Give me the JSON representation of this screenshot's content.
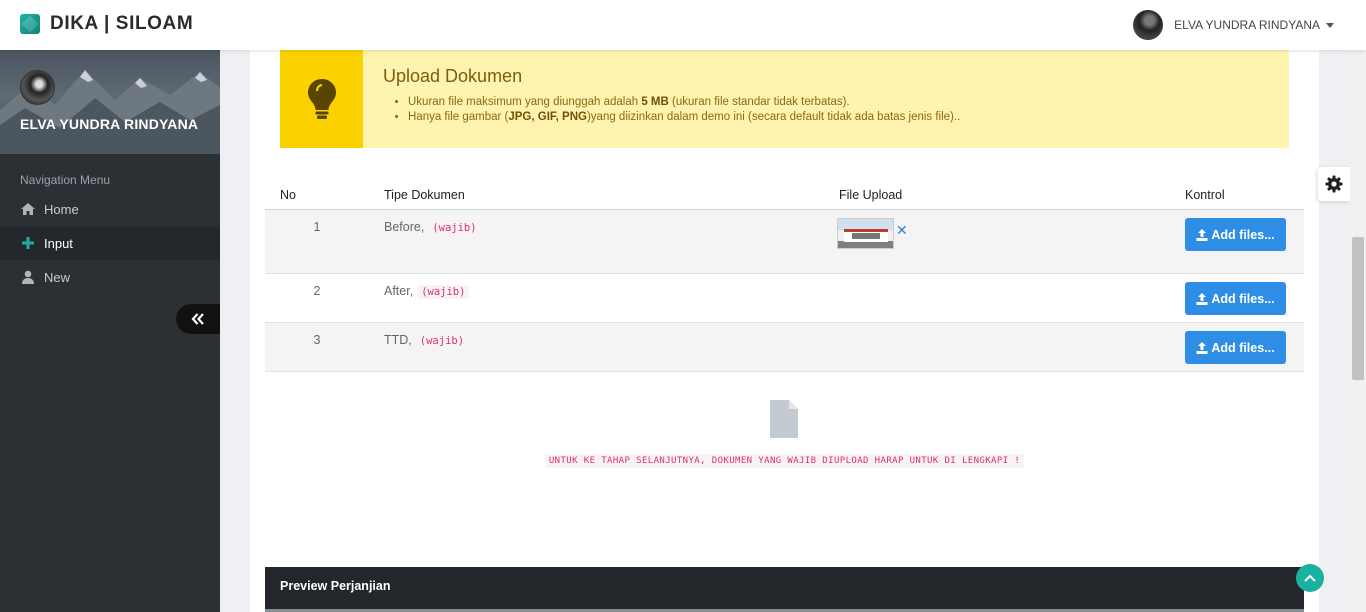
{
  "app": {
    "brand": "DIKA | SILOAM"
  },
  "header": {
    "user_name": "ELVA YUNDRA RINDYANA"
  },
  "sidebar": {
    "profile_name": "ELVA YUNDRA RINDYANA",
    "nav_title": "Navigation Menu",
    "items": [
      {
        "label": "Home",
        "icon": "home-icon"
      },
      {
        "label": "Input",
        "icon": "plus-icon",
        "active": true
      },
      {
        "label": "New",
        "icon": "user-icon"
      }
    ]
  },
  "alert": {
    "title": "Upload Dokumen",
    "line1_pre": "Ukuran file maksimum yang diunggah adalah ",
    "line1_bold": "5 MB",
    "line1_post": " (ukuran file standar tidak terbatas).",
    "line2_pre": "Hanya file gambar (",
    "line2_bold": "JPG, GIF, PNG",
    "line2_post": ")yang diizinkan dalam demo ini (secara default tidak ada batas jenis file).."
  },
  "table": {
    "headers": {
      "no": "No",
      "type": "Tipe Dokumen",
      "file": "File Upload",
      "control": "Kontrol"
    },
    "rows": [
      {
        "no": "1",
        "type": "Before,",
        "tag": "(wajib)",
        "has_file": true,
        "button": "Add files..."
      },
      {
        "no": "2",
        "type": "After,",
        "tag": "(wajib)",
        "has_file": false,
        "button": "Add files..."
      },
      {
        "no": "3",
        "type": "TTD,",
        "tag": "(wajib)",
        "has_file": false,
        "button": "Add files..."
      }
    ]
  },
  "notice": "UNTUK KE TAHAP SELANJUTNYA, DOKUMEN YANG WAJIB DIUPLOAD HARAP UNTUK DI LENGKAPI !",
  "preview": {
    "title": "Preview Perjanjian"
  },
  "colors": {
    "accent": "#1ab1a1",
    "button": "#2e8ee6",
    "alert_bg": "#fff3b0",
    "alert_side": "#fbd200",
    "danger_text": "#d6336c"
  }
}
